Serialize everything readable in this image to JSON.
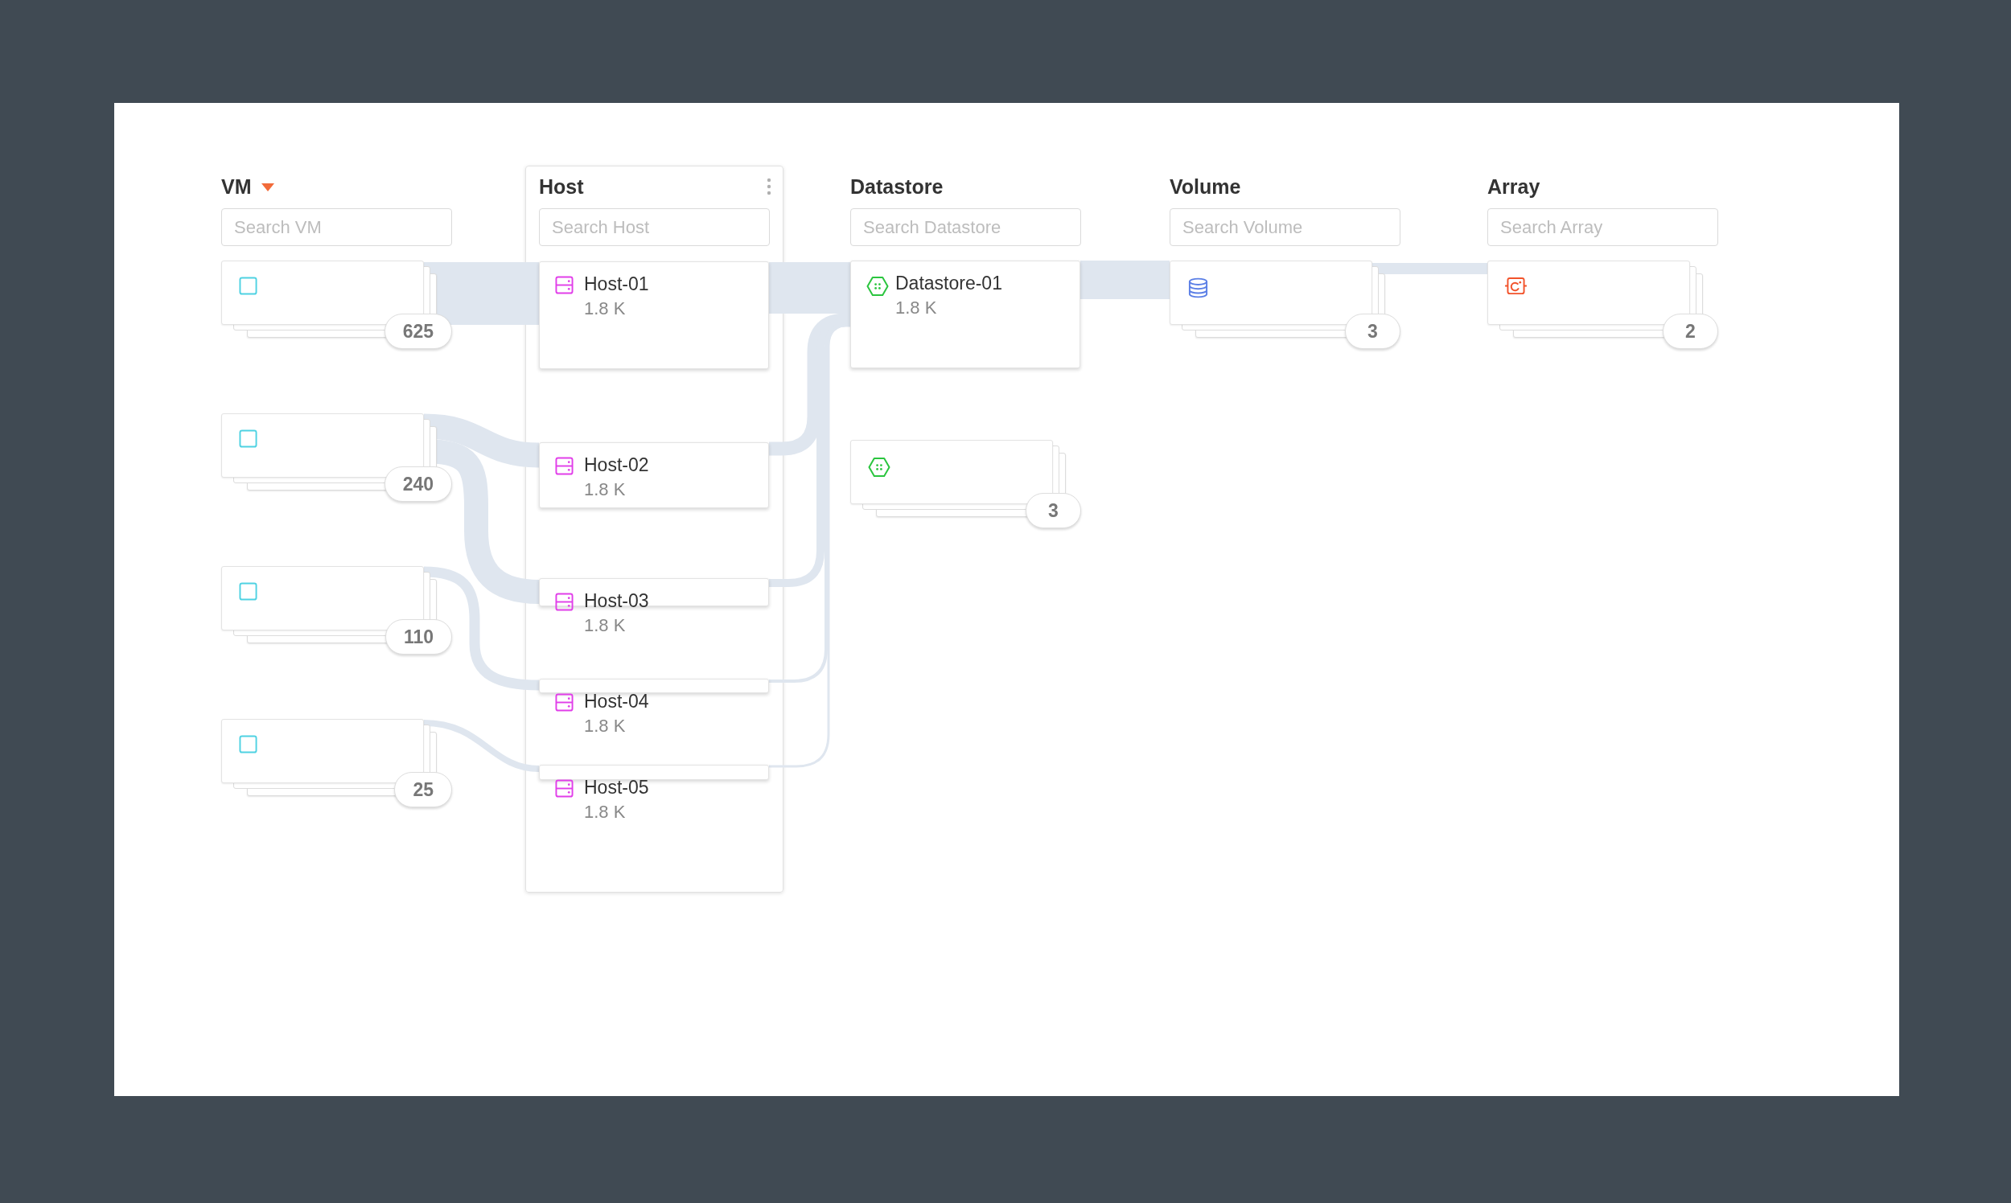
{
  "columns": [
    {
      "kind": "vm",
      "title": "VM",
      "selected": true,
      "highlighted": false,
      "search": {
        "placeholder": "Search VM"
      },
      "nodes": [
        {
          "kind": "group",
          "count": "625"
        },
        {
          "kind": "group",
          "count": "240"
        },
        {
          "kind": "group",
          "count": "110"
        },
        {
          "kind": "group",
          "count": "25"
        }
      ]
    },
    {
      "kind": "host",
      "title": "Host",
      "selected": false,
      "highlighted": true,
      "search": {
        "placeholder": "Search Host"
      },
      "nodes": [
        {
          "kind": "single",
          "name": "Host-01",
          "value": "1.8 K"
        },
        {
          "kind": "single",
          "name": "Host-02",
          "value": "1.8 K"
        },
        {
          "kind": "single",
          "name": "Host-03",
          "value": "1.8 K"
        },
        {
          "kind": "single",
          "name": "Host-04",
          "value": "1.8 K"
        },
        {
          "kind": "single",
          "name": "Host-05",
          "value": "1.8 K"
        }
      ]
    },
    {
      "kind": "datastore",
      "title": "Datastore",
      "selected": false,
      "highlighted": false,
      "search": {
        "placeholder": "Search Datastore"
      },
      "nodes": [
        {
          "kind": "single",
          "name": "Datastore-01",
          "value": "1.8 K"
        },
        {
          "kind": "group",
          "count": "3"
        }
      ]
    },
    {
      "kind": "volume",
      "title": "Volume",
      "selected": false,
      "highlighted": false,
      "search": {
        "placeholder": "Search Volume"
      },
      "nodes": [
        {
          "kind": "group",
          "count": "3"
        }
      ]
    },
    {
      "kind": "array",
      "title": "Array",
      "selected": false,
      "highlighted": false,
      "search": {
        "placeholder": "Search Array"
      },
      "nodes": [
        {
          "kind": "group",
          "count": "2"
        }
      ]
    }
  ]
}
